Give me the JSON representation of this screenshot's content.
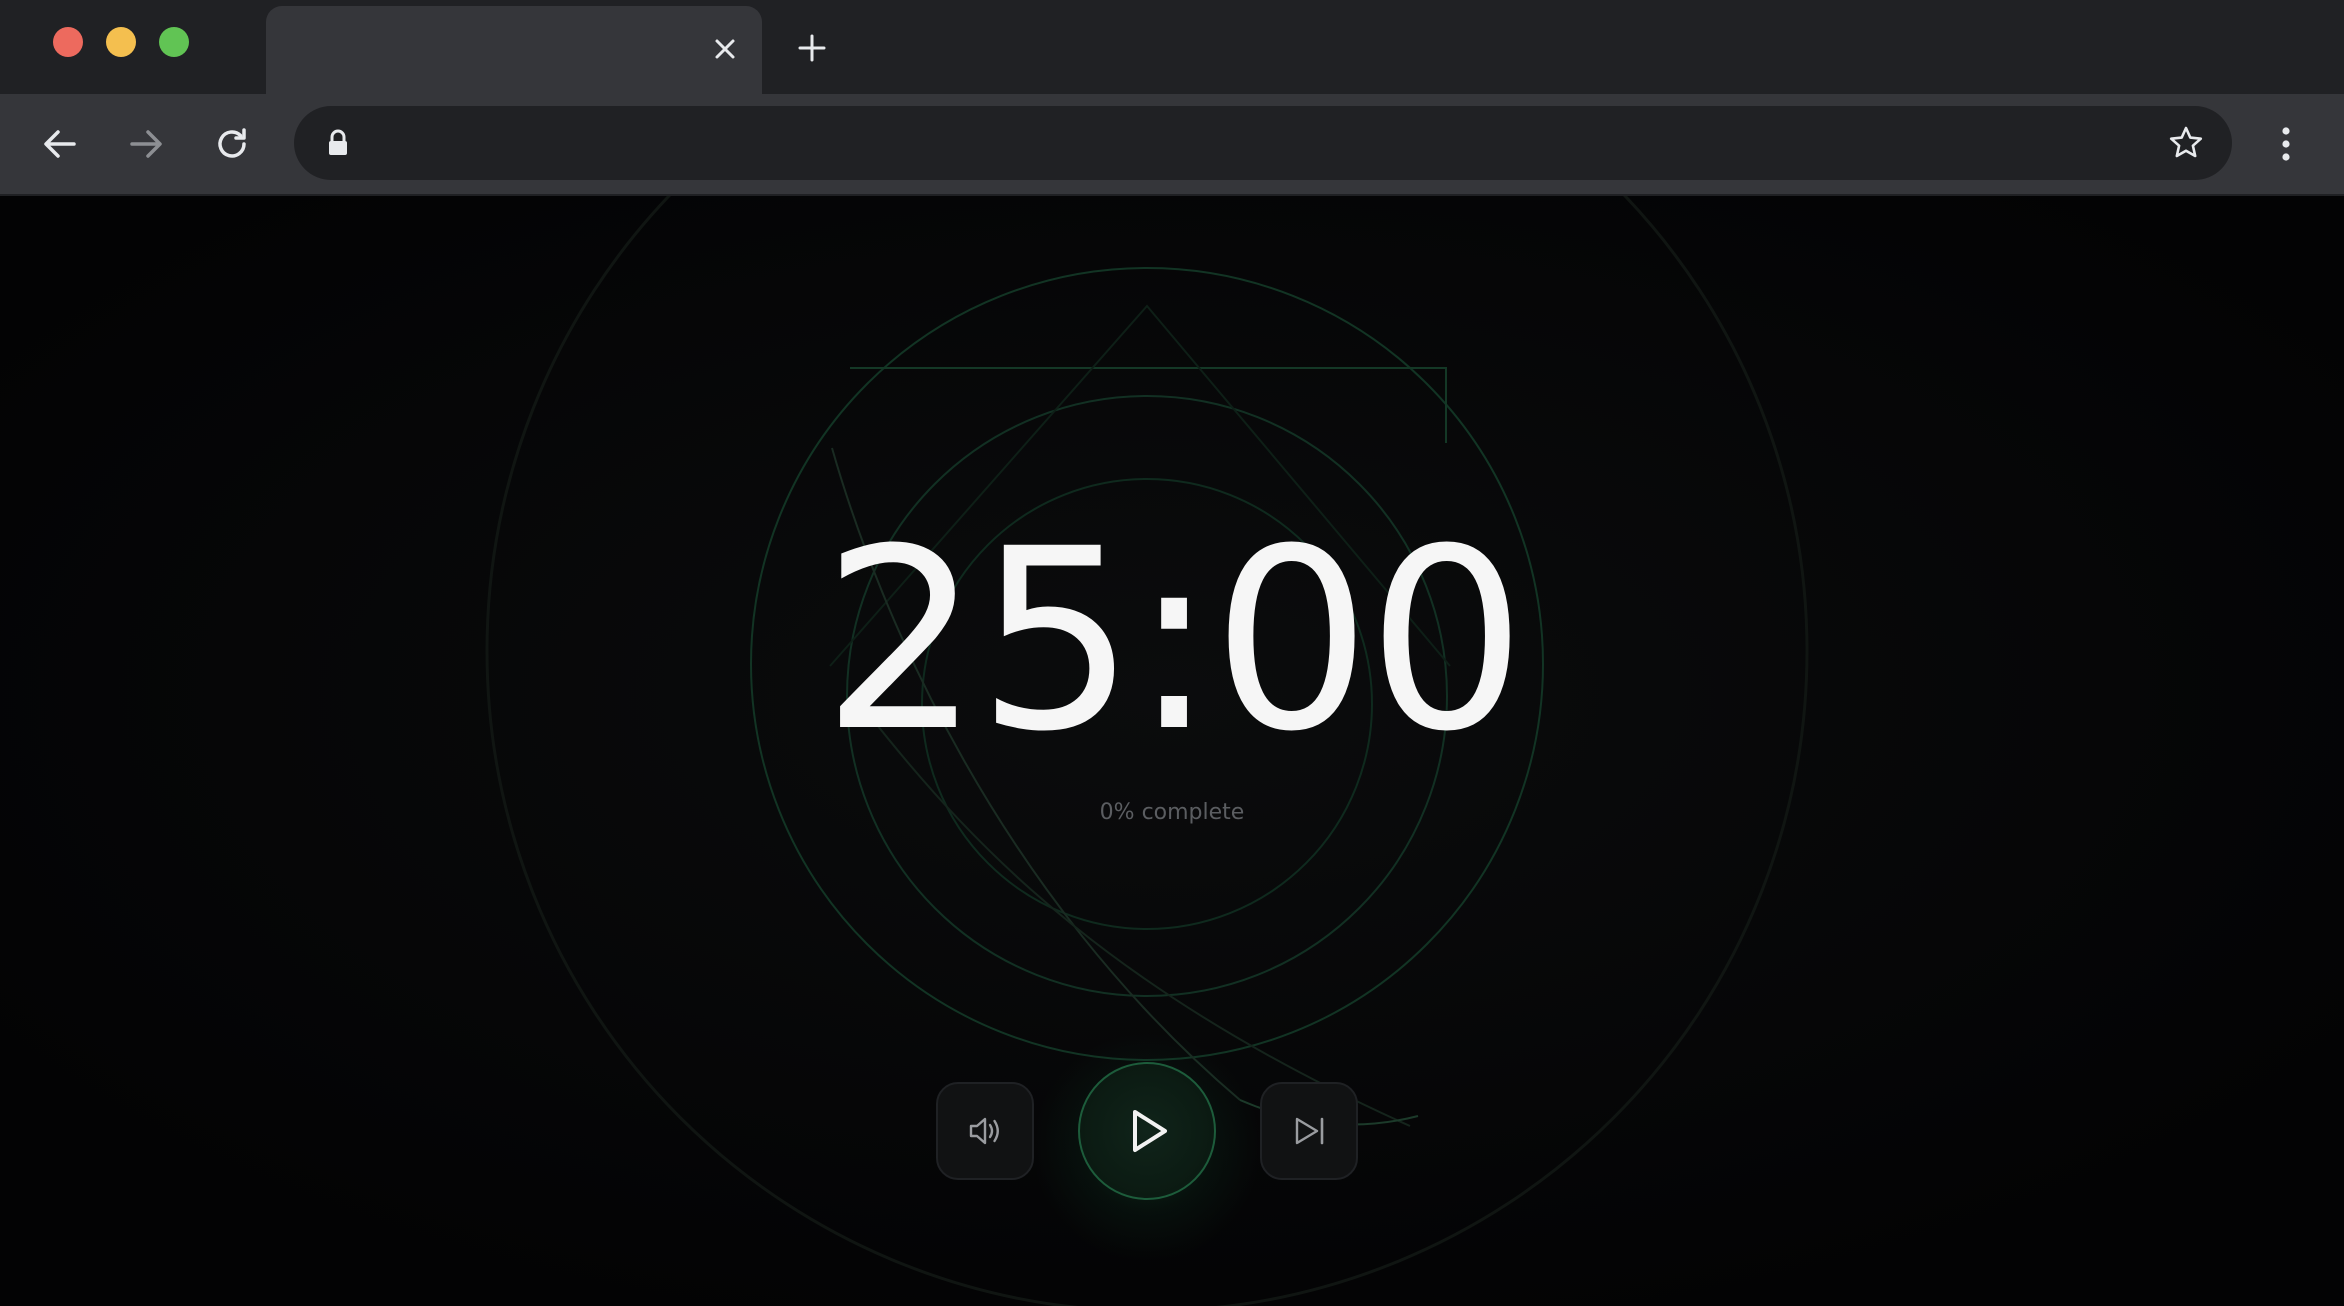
{
  "browser": {
    "tab_title": "",
    "url": "",
    "icons": {
      "tab_close": "close-icon",
      "new_tab": "plus-icon",
      "back": "arrow-left-icon",
      "forward": "arrow-right-icon",
      "reload": "reload-icon",
      "lock": "lock-icon",
      "bookmark": "star-icon",
      "menu": "kebab-menu-icon"
    },
    "traffic_lights": {
      "close": "#ed6a5e",
      "minimize": "#f4bf4f",
      "maximize": "#61c454"
    }
  },
  "timer": {
    "display": "25:00",
    "progress_label": "0% complete",
    "progress_fraction": 0
  },
  "controls": {
    "sound": {
      "icon": "volume-icon"
    },
    "play": {
      "icon": "play-icon"
    },
    "skip": {
      "icon": "skip-forward-icon"
    }
  },
  "colors": {
    "background": "#040405",
    "accent_green": "#1d5c3b",
    "timer_text": "#f6f6f6",
    "muted_text": "#5b5d61"
  }
}
